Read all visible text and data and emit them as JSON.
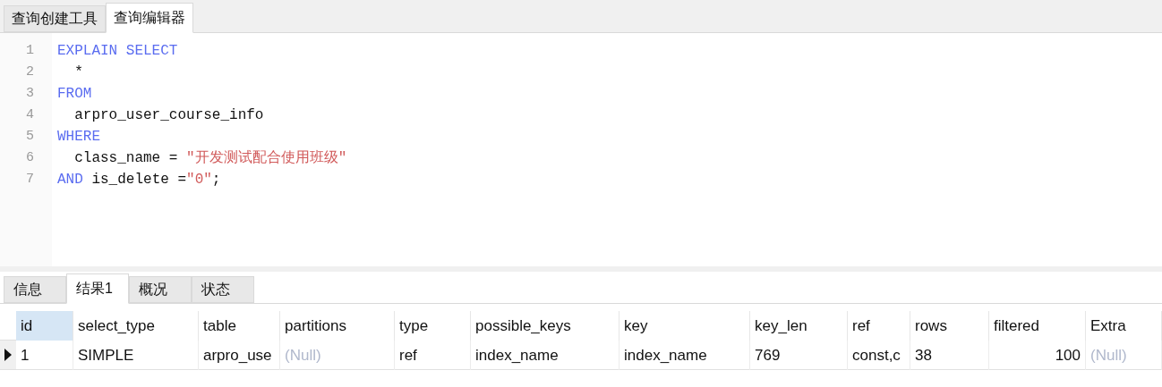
{
  "editor_tabs": [
    {
      "label": "查询创建工具",
      "selected": false
    },
    {
      "label": "查询编辑器",
      "selected": true
    }
  ],
  "code_lines": [
    {
      "number": "1",
      "tokens": [
        {
          "kind": "keyword",
          "text": "EXPLAIN SELECT"
        }
      ]
    },
    {
      "number": "2",
      "tokens": [
        {
          "kind": "plain",
          "text": "  *"
        }
      ]
    },
    {
      "number": "3",
      "tokens": [
        {
          "kind": "keyword",
          "text": "FROM"
        }
      ]
    },
    {
      "number": "4",
      "tokens": [
        {
          "kind": "plain",
          "text": "  arpro_user_course_info"
        }
      ]
    },
    {
      "number": "5",
      "tokens": [
        {
          "kind": "keyword",
          "text": "WHERE"
        }
      ]
    },
    {
      "number": "6",
      "tokens": [
        {
          "kind": "plain",
          "text": "  class_name = "
        },
        {
          "kind": "string",
          "text": "\"开发测试配合使用班级\""
        }
      ]
    },
    {
      "number": "7",
      "tokens": [
        {
          "kind": "keyword",
          "text": "AND"
        },
        {
          "kind": "plain",
          "text": " is_delete ="
        },
        {
          "kind": "string",
          "text": "\"0"
        },
        {
          "kind": "string",
          "text": "\""
        },
        {
          "kind": "plain",
          "text": ";"
        }
      ]
    }
  ],
  "result_tabs": [
    {
      "label": "信息",
      "selected": false
    },
    {
      "label": "结果1",
      "selected": true
    },
    {
      "label": "概况",
      "selected": false
    },
    {
      "label": "状态",
      "selected": false
    }
  ],
  "table": {
    "columns": [
      {
        "label": "id",
        "selected": true
      },
      {
        "label": "select_type",
        "selected": false
      },
      {
        "label": "table",
        "selected": false
      },
      {
        "label": "partitions",
        "selected": false
      },
      {
        "label": "type",
        "selected": false
      },
      {
        "label": "possible_keys",
        "selected": false
      },
      {
        "label": "key",
        "selected": false
      },
      {
        "label": "key_len",
        "selected": false
      },
      {
        "label": "ref",
        "selected": false
      },
      {
        "label": "rows",
        "selected": false
      },
      {
        "label": "filtered",
        "selected": false
      },
      {
        "label": "Extra",
        "selected": false
      }
    ],
    "rows": [
      {
        "selected": true,
        "cells": [
          {
            "kind": "text",
            "text": "1"
          },
          {
            "kind": "text",
            "text": "SIMPLE"
          },
          {
            "kind": "text",
            "text": "arpro_use"
          },
          {
            "kind": "null",
            "text": "(Null)"
          },
          {
            "kind": "text",
            "text": "ref"
          },
          {
            "kind": "text",
            "text": "index_name"
          },
          {
            "kind": "text",
            "text": "index_name"
          },
          {
            "kind": "text",
            "text": "769"
          },
          {
            "kind": "text",
            "text": "const,c"
          },
          {
            "kind": "text",
            "text": "38"
          },
          {
            "kind": "number",
            "text": "100"
          },
          {
            "kind": "null",
            "text": "(Null)"
          }
        ]
      }
    ]
  }
}
